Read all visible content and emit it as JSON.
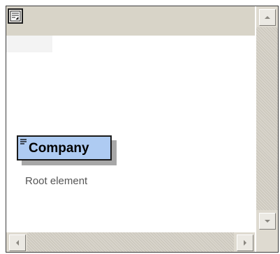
{
  "diagram": {
    "root_node": {
      "label": "Company",
      "icon": "element-lines-icon"
    },
    "caption": "Root element"
  },
  "toolbar": {
    "button_icon": "document-icon"
  },
  "scrollbars": {
    "vertical": {
      "up_icon": "arrow-up-icon",
      "down_icon": "arrow-down-icon"
    },
    "horizontal": {
      "left_icon": "arrow-left-icon",
      "right_icon": "arrow-right-icon"
    }
  }
}
